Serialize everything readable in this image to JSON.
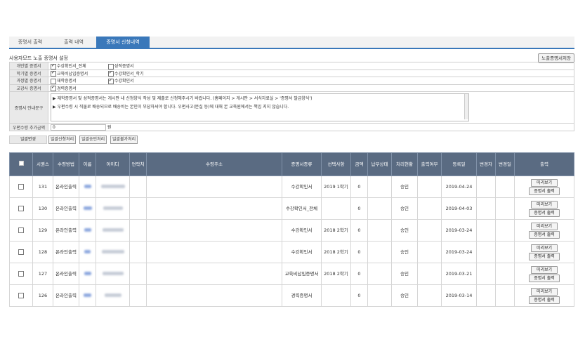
{
  "tabs": [
    {
      "label": "증명서 출력",
      "active": false
    },
    {
      "label": "출력 내역",
      "active": false
    },
    {
      "label": "증명서 신청내역",
      "active": true
    }
  ],
  "settings": {
    "title": "사용자모드 노출 증명서 설정",
    "save_button": "노출증명서저장",
    "rows": [
      {
        "label": "개인별 증명서",
        "options": [
          {
            "text": "수강확인서_전체",
            "checked": true
          },
          {
            "text": "성적증명서",
            "checked": false
          }
        ]
      },
      {
        "label": "학기별 증명서",
        "options": [
          {
            "text": "교육비납입증명서",
            "checked": true
          },
          {
            "text": "수강확인서_학기",
            "checked": true
          }
        ]
      },
      {
        "label": "과정별 증명서",
        "options": [
          {
            "text": "재학증명서",
            "checked": false
          },
          {
            "text": "수강확인서",
            "checked": true
          }
        ]
      },
      {
        "label": "교강사 증명서",
        "options": [
          {
            "text": "경력증명서",
            "checked": true
          }
        ]
      }
    ],
    "guide_label": "증명서 안내문구",
    "guide_lines": [
      "▶ 재학증명서 및 성적증명서는 게시판 내 신청양식 작성 및 제출로 신청해주시기 바랍니다. (홈페이지 > 게시판 > 서식자료실 > '증명서 발급양식')",
      "▶ 우편수령 시 직물로 배송되므로 배송비는 본인이 부담하셔야 합니다. 우편사고(분실 등)에 대해 본 교육원에서는 책임 지지 않습니다."
    ],
    "postal_label": "우편수령 추가금액",
    "postal_value": "0",
    "postal_unit": "원"
  },
  "bulk": {
    "label": "일괄변경",
    "buttons": [
      "일괄신청처리",
      "일괄승인처리",
      "일괄불가처리"
    ]
  },
  "table": {
    "headers": [
      "",
      "시퀀스",
      "수령방법",
      "이름",
      "아이디",
      "연락처",
      "수령주소",
      "증명서종류",
      "선택사항",
      "금액",
      "납부상태",
      "처리현황",
      "출력여부",
      "등록일",
      "변경자",
      "변경일",
      "출력"
    ],
    "preview_label": "미리보기",
    "print_label": "증명서 출력",
    "rows": [
      {
        "seq": "131",
        "method": "온라인출력",
        "type": "수강확인서",
        "option": "2019 1학기",
        "amount": "0",
        "status": "승인",
        "date": "2019-04-24"
      },
      {
        "seq": "130",
        "method": "온라인출력",
        "type": "수강확인서_전체",
        "option": "",
        "amount": "0",
        "status": "승인",
        "date": "2019-04-03"
      },
      {
        "seq": "129",
        "method": "온라인출력",
        "type": "수강확인서",
        "option": "2018 2학기",
        "amount": "0",
        "status": "승인",
        "date": "2019-03-24"
      },
      {
        "seq": "128",
        "method": "온라인출력",
        "type": "수강확인서",
        "option": "2018 2학기",
        "amount": "0",
        "status": "승인",
        "date": "2019-03-24"
      },
      {
        "seq": "127",
        "method": "온라인출력",
        "type": "교육비납입증명서",
        "option": "2018 2학기",
        "amount": "0",
        "status": "승인",
        "date": "2019-03-21"
      },
      {
        "seq": "126",
        "method": "온라인출력",
        "type": "경력증명서",
        "option": "",
        "amount": "0",
        "status": "승인",
        "date": "2019-03-14"
      }
    ]
  },
  "colors": {
    "accent": "#3a78ba",
    "header_bg": "#5a6b82"
  }
}
